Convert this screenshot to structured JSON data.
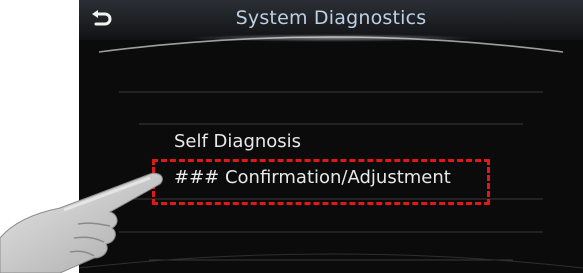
{
  "header": {
    "title": "System Diagnostics"
  },
  "back_button": {
    "icon": "back-arrow-icon"
  },
  "menu": {
    "items": [
      {
        "label": "Self Diagnosis"
      },
      {
        "label": "### Confirmation/Adjustment"
      }
    ]
  },
  "highlight": {
    "color": "#e01818"
  },
  "pointer": {
    "icon": "pointing-hand-icon"
  }
}
